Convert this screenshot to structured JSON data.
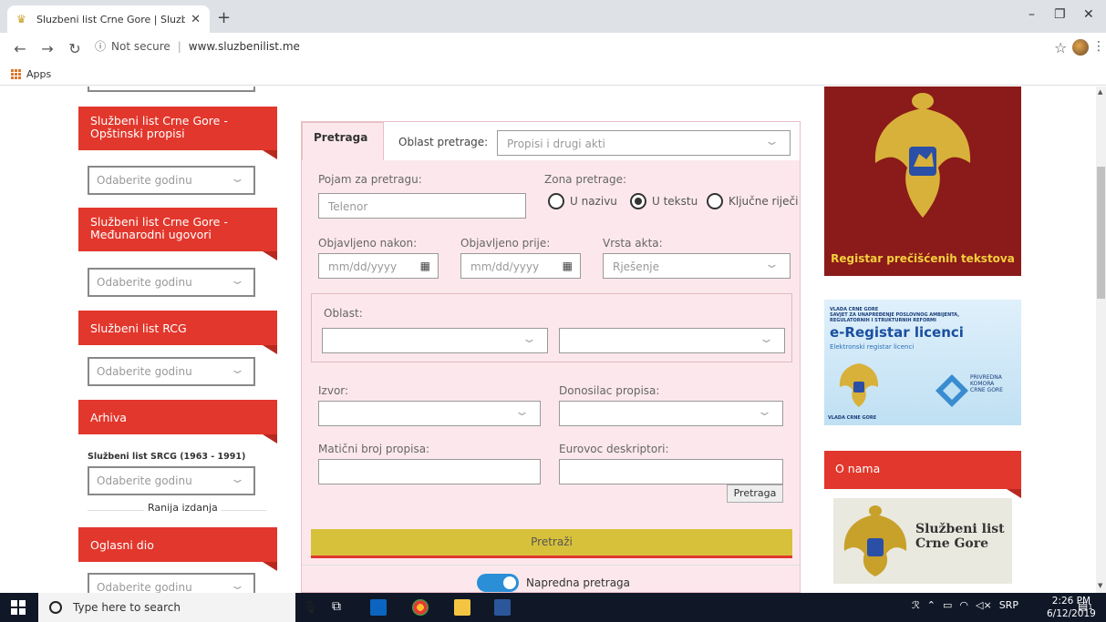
{
  "browser": {
    "tab_title": "Sluzbeni list Crne Gore | Sluzbeni",
    "new_tab": "+",
    "not_secure": "Not secure",
    "url": "www.sluzbenilist.me",
    "bookmark_apps": "Apps"
  },
  "window": {
    "minimize": "–",
    "restore": "❐",
    "close": "✕"
  },
  "sidebar": {
    "sections": [
      {
        "title": "Službeni list Crne Gore - Opštinski propisi",
        "select": "Odaberite godinu"
      },
      {
        "title": "Službeni list Crne Gore - Međunarodni ugovori",
        "select": "Odaberite godinu"
      },
      {
        "title": "Službeni list RCG",
        "select": "Odaberite godinu"
      },
      {
        "title": "Arhiva",
        "sub": "Službeni list SRCG (1963 - 1991)",
        "select": "Odaberite godinu",
        "link": "Ranija izdanja"
      },
      {
        "title": "Oglasni dio",
        "select": "Odaberite godinu"
      }
    ]
  },
  "search": {
    "tab_label": "Pretraga",
    "oblast_pretrage_label": "Oblast pretrage:",
    "oblast_pretrage_value": "Propisi i drugi akti",
    "pojam_label": "Pojam za pretragu:",
    "pojam_value": "Telenor",
    "zona_label": "Zona pretrage:",
    "zona_options": [
      "U nazivu",
      "U tekstu",
      "Ključne riječi"
    ],
    "zona_selected": "U tekstu",
    "objavljeno_nakon_label": "Objavljeno nakon:",
    "objavljeno_prije_label": "Objavljeno prije:",
    "date_placeholder": "mm/dd/yyyy",
    "vrsta_akta_label": "Vrsta akta:",
    "vrsta_akta_value": "Rješenje",
    "oblast_label": "Oblast:",
    "izvor_label": "Izvor:",
    "donosilac_label": "Donosilac propisa:",
    "maticni_label": "Matični broj propisa:",
    "eurovoc_label": "Eurovoc deskriptori:",
    "eurovoc_button": "Pretraga",
    "submit": "Pretraži",
    "advanced_label": "Napredna pretraga",
    "advanced_on": true
  },
  "right": {
    "register_banner": "Registar prečišćenih tekstova",
    "elicence": {
      "header": "VLADA CRNE GORE\nSAVJET ZA UNAPREĐENJE POSLOVNOG AMBIJENTA,\nREGULATORNIH I STRUKTURNIH REFORMI",
      "title": "e-Registar licenci",
      "subtitle": "Elektronski registar licenci",
      "partner": "PRIVREDNA\nKOMORA\nCRNE GORE",
      "footer": "VLADA CRNE GORE"
    },
    "about_title": "O nama",
    "about_logo_text": "Službeni list\nCrne Gore"
  },
  "taskbar": {
    "search_placeholder": "Type here to search",
    "lang": "SRP",
    "time": "2:26 PM",
    "date": "6/12/2019",
    "notif": "1"
  }
}
